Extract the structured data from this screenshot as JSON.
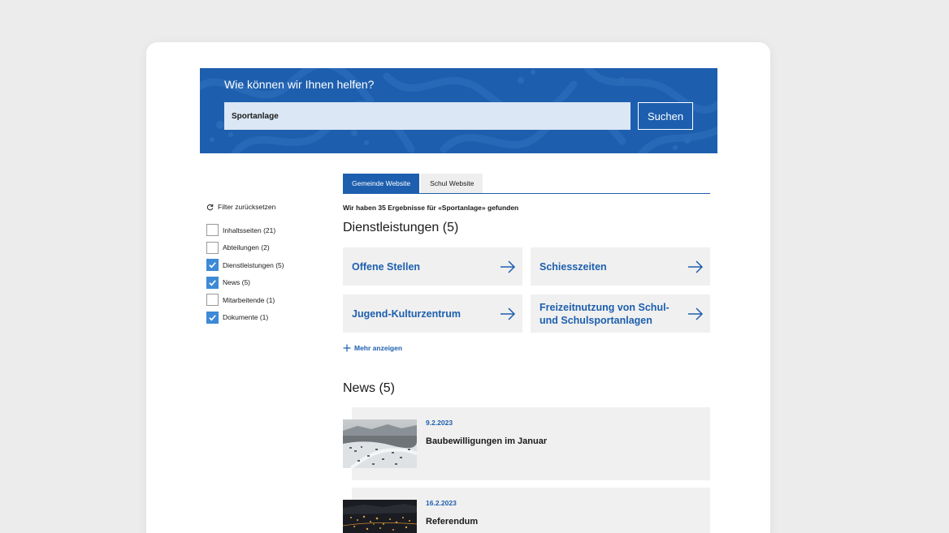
{
  "hero": {
    "title": "Wie können wir Ihnen helfen?",
    "search_value": "Sportanlage",
    "search_button": "Suchen"
  },
  "filters": {
    "reset_label": "Filter zurücksetzen",
    "items": [
      {
        "label": "Inhaltsseiten (21)",
        "checked": false
      },
      {
        "label": "Abteilungen (2)",
        "checked": false
      },
      {
        "label": "Dienstleistungen (5)",
        "checked": true
      },
      {
        "label": "News (5)",
        "checked": true
      },
      {
        "label": "Mitarbeitende (1)",
        "checked": false
      },
      {
        "label": "Dokumente (1)",
        "checked": true
      }
    ]
  },
  "tabs": [
    {
      "label": "Gemeinde Website",
      "active": true
    },
    {
      "label": "Schul Website",
      "active": false
    }
  ],
  "results": {
    "count_text": "Wir haben 35 Ergebnisse für «Sportanlage» gefunden"
  },
  "services": {
    "heading": "Dienstleistungen (5)",
    "cards": [
      {
        "title": "Offene Stellen"
      },
      {
        "title": "Schiesszeiten"
      },
      {
        "title": "Jugend-Kulturzentrum"
      },
      {
        "title": "Freizeitnutzung von Schul- und Schulsportanlagen"
      }
    ],
    "more_label": "Mehr anzeigen"
  },
  "news": {
    "heading": "News (5)",
    "items": [
      {
        "date": "9.2.2023",
        "title": "Baubewilligungen im Januar",
        "image": "aerial-winter-town-photo"
      },
      {
        "date": "16.2.2023",
        "title": "Referendum",
        "image": "night-town-lights-photo"
      }
    ]
  },
  "colors": {
    "brand_blue": "#1d5fae",
    "checkbox_blue": "#3d8ad6",
    "card_grey": "#f0f0f0",
    "page_bg": "#ececec"
  }
}
